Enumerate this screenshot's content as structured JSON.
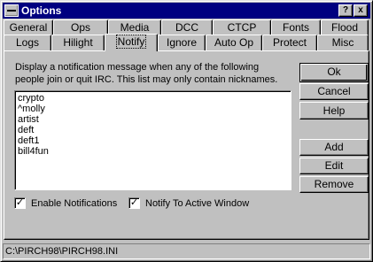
{
  "window": {
    "title": "Options",
    "help_label": "?",
    "close_label": "x"
  },
  "tabs_row1": [
    "General",
    "Ops",
    "Media",
    "DCC",
    "CTCP",
    "Fonts",
    "Flood"
  ],
  "tabs_row2": [
    "Logs",
    "Hilight",
    "Notify",
    "Ignore",
    "Auto Op",
    "Protect",
    "Misc"
  ],
  "active_tab": "Notify",
  "notify": {
    "description": "Display a notification message when any of the following people join or quit IRC. This list may only contain nicknames.",
    "nicknames": [
      "crypto",
      "^molly",
      "artist",
      "deft",
      "deft1",
      "bill4fun"
    ],
    "enable_notifications": {
      "label": "Enable Notifications",
      "checked": true
    },
    "notify_active_window": {
      "label": "Notify To Active Window",
      "checked": true
    }
  },
  "buttons": {
    "ok": "Ok",
    "cancel": "Cancel",
    "help": "Help",
    "add": "Add",
    "edit": "Edit",
    "remove": "Remove"
  },
  "status": {
    "path": "C:\\PIRCH98\\PIRCH98.INI"
  }
}
